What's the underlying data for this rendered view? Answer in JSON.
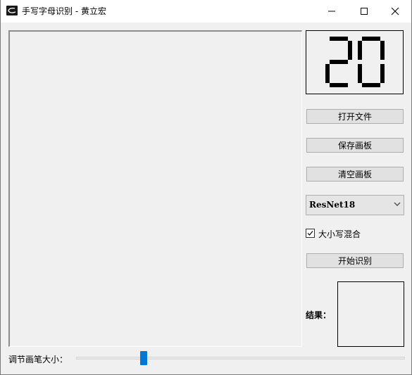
{
  "window": {
    "title": "手写字母识别 - 黄立宏"
  },
  "display": {
    "digits": "20"
  },
  "buttons": {
    "open_file": "打开文件",
    "save_canvas": "保存画板",
    "clear_canvas": "清空画板",
    "start_recognition": "开始识别"
  },
  "model_select": {
    "value": "ResNet18",
    "icon": "chevron-down-icon"
  },
  "mixed_case": {
    "label": "大小写混合",
    "checked": true
  },
  "result": {
    "label": "结果："
  },
  "brush_size": {
    "label": "调节画笔大小：",
    "level_fraction": 0.2
  },
  "colors": {
    "accent": "#0078d7",
    "window_bg": "#f0f0f0"
  }
}
